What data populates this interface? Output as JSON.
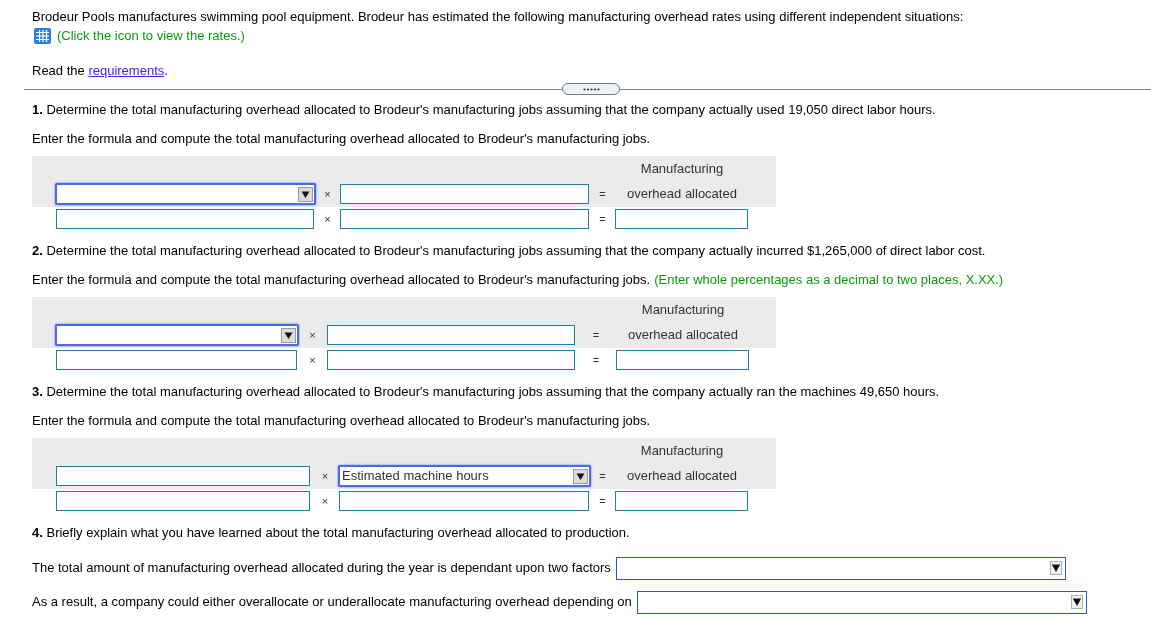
{
  "intro": {
    "text": "Brodeur Pools manufactures swimming pool equipment. Brodeur has estimated the following manufacturing overhead rates using different independent situations:",
    "hint": "(Click the icon to view the rates.)"
  },
  "requirements": {
    "before": "Read the ",
    "link": "requirements",
    "after": "."
  },
  "questions": [
    {
      "text": "**1.** Determine the total manufacturing overhead allocated to Brodeur's manufacturing jobs assuming that the company actually used 19,050 direct labor hours.",
      "instruction": "Enter the formula and compute the total manufacturing overhead allocated to Brodeur's manufacturing jobs.",
      "formula": {
        "header": "Manufacturing",
        "rows": [
          [
            {
              "kind": "select"
            },
            {
              "kind": "operator",
              "text": "×"
            },
            {
              "kind": "input"
            },
            {
              "kind": "operator",
              "text": "="
            },
            {
              "kind": "label",
              "text": "overhead allocated"
            }
          ],
          [
            {
              "kind": "input"
            },
            {
              "kind": "operator",
              "text": "×"
            },
            {
              "kind": "input"
            },
            {
              "kind": "operator",
              "text": "="
            },
            {
              "kind": "input"
            }
          ]
        ]
      }
    },
    {
      "text": "**2.** Determine the total manufacturing overhead allocated to Brodeur's manufacturing jobs assuming that the company actually incurred $1,265,000 of direct labor cost.",
      "instruction": "Enter the formula and compute the total manufacturing overhead allocated to Brodeur's manufacturing jobs.",
      "note": "(Enter whole percentages as a decimal to two places, X.XX.)",
      "formula": {
        "header": "Manufacturing",
        "rows": [
          [
            {
              "kind": "select"
            },
            {
              "kind": "operator",
              "text": "×"
            },
            {
              "kind": "input"
            },
            {
              "kind": "operator",
              "text": "="
            },
            {
              "kind": "label",
              "text": "overhead allocated"
            }
          ],
          [
            {
              "kind": "input"
            },
            {
              "kind": "operator",
              "text": "×"
            },
            {
              "kind": "input"
            },
            {
              "kind": "operator",
              "text": "="
            },
            {
              "kind": "input"
            }
          ]
        ]
      }
    },
    {
      "text": "**3.** Determine the total manufacturing overhead allocated to Brodeur's manufacturing jobs assuming that the company actually ran the machines 49,650 hours.",
      "instruction": "Enter the formula and compute the total manufacturing overhead allocated to Brodeur's manufacturing jobs.",
      "formula": {
        "header": "Manufacturing",
        "rows": [
          [
            {
              "kind": "input"
            },
            {
              "kind": "operator",
              "text": "×"
            },
            {
              "kind": "select",
              "value": "Estimated machine hours"
            },
            {
              "kind": "operator",
              "text": "="
            },
            {
              "kind": "label",
              "text": "overhead allocated"
            }
          ],
          [
            {
              "kind": "input"
            },
            {
              "kind": "operator",
              "text": "×"
            },
            {
              "kind": "input"
            },
            {
              "kind": "operator",
              "text": "="
            },
            {
              "kind": "input"
            }
          ]
        ]
      }
    },
    {
      "text": "**4.** Briefly explain what you have learned about the total manufacturing overhead allocated to production.",
      "answers": [
        {
          "text": "The total amount of manufacturing overhead allocated during the year is dependant upon two factors"
        },
        {
          "text": "As a result, a company could either overallocate or underallocate manufacturing overhead depending on"
        }
      ]
    }
  ]
}
